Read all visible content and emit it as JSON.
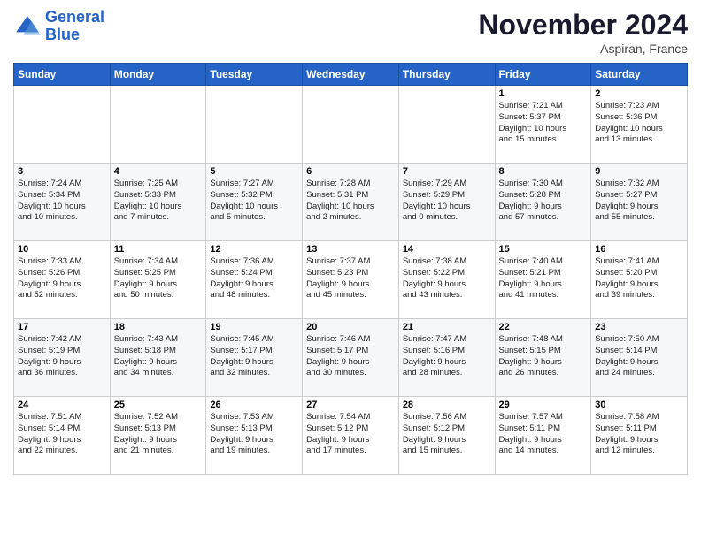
{
  "logo": {
    "line1": "General",
    "line2": "Blue"
  },
  "title": "November 2024",
  "location": "Aspiran, France",
  "headers": [
    "Sunday",
    "Monday",
    "Tuesday",
    "Wednesday",
    "Thursday",
    "Friday",
    "Saturday"
  ],
  "weeks": [
    [
      {
        "day": "",
        "info": ""
      },
      {
        "day": "",
        "info": ""
      },
      {
        "day": "",
        "info": ""
      },
      {
        "day": "",
        "info": ""
      },
      {
        "day": "",
        "info": ""
      },
      {
        "day": "1",
        "info": "Sunrise: 7:21 AM\nSunset: 5:37 PM\nDaylight: 10 hours\nand 15 minutes."
      },
      {
        "day": "2",
        "info": "Sunrise: 7:23 AM\nSunset: 5:36 PM\nDaylight: 10 hours\nand 13 minutes."
      }
    ],
    [
      {
        "day": "3",
        "info": "Sunrise: 7:24 AM\nSunset: 5:34 PM\nDaylight: 10 hours\nand 10 minutes."
      },
      {
        "day": "4",
        "info": "Sunrise: 7:25 AM\nSunset: 5:33 PM\nDaylight: 10 hours\nand 7 minutes."
      },
      {
        "day": "5",
        "info": "Sunrise: 7:27 AM\nSunset: 5:32 PM\nDaylight: 10 hours\nand 5 minutes."
      },
      {
        "day": "6",
        "info": "Sunrise: 7:28 AM\nSunset: 5:31 PM\nDaylight: 10 hours\nand 2 minutes."
      },
      {
        "day": "7",
        "info": "Sunrise: 7:29 AM\nSunset: 5:29 PM\nDaylight: 10 hours\nand 0 minutes."
      },
      {
        "day": "8",
        "info": "Sunrise: 7:30 AM\nSunset: 5:28 PM\nDaylight: 9 hours\nand 57 minutes."
      },
      {
        "day": "9",
        "info": "Sunrise: 7:32 AM\nSunset: 5:27 PM\nDaylight: 9 hours\nand 55 minutes."
      }
    ],
    [
      {
        "day": "10",
        "info": "Sunrise: 7:33 AM\nSunset: 5:26 PM\nDaylight: 9 hours\nand 52 minutes."
      },
      {
        "day": "11",
        "info": "Sunrise: 7:34 AM\nSunset: 5:25 PM\nDaylight: 9 hours\nand 50 minutes."
      },
      {
        "day": "12",
        "info": "Sunrise: 7:36 AM\nSunset: 5:24 PM\nDaylight: 9 hours\nand 48 minutes."
      },
      {
        "day": "13",
        "info": "Sunrise: 7:37 AM\nSunset: 5:23 PM\nDaylight: 9 hours\nand 45 minutes."
      },
      {
        "day": "14",
        "info": "Sunrise: 7:38 AM\nSunset: 5:22 PM\nDaylight: 9 hours\nand 43 minutes."
      },
      {
        "day": "15",
        "info": "Sunrise: 7:40 AM\nSunset: 5:21 PM\nDaylight: 9 hours\nand 41 minutes."
      },
      {
        "day": "16",
        "info": "Sunrise: 7:41 AM\nSunset: 5:20 PM\nDaylight: 9 hours\nand 39 minutes."
      }
    ],
    [
      {
        "day": "17",
        "info": "Sunrise: 7:42 AM\nSunset: 5:19 PM\nDaylight: 9 hours\nand 36 minutes."
      },
      {
        "day": "18",
        "info": "Sunrise: 7:43 AM\nSunset: 5:18 PM\nDaylight: 9 hours\nand 34 minutes."
      },
      {
        "day": "19",
        "info": "Sunrise: 7:45 AM\nSunset: 5:17 PM\nDaylight: 9 hours\nand 32 minutes."
      },
      {
        "day": "20",
        "info": "Sunrise: 7:46 AM\nSunset: 5:17 PM\nDaylight: 9 hours\nand 30 minutes."
      },
      {
        "day": "21",
        "info": "Sunrise: 7:47 AM\nSunset: 5:16 PM\nDaylight: 9 hours\nand 28 minutes."
      },
      {
        "day": "22",
        "info": "Sunrise: 7:48 AM\nSunset: 5:15 PM\nDaylight: 9 hours\nand 26 minutes."
      },
      {
        "day": "23",
        "info": "Sunrise: 7:50 AM\nSunset: 5:14 PM\nDaylight: 9 hours\nand 24 minutes."
      }
    ],
    [
      {
        "day": "24",
        "info": "Sunrise: 7:51 AM\nSunset: 5:14 PM\nDaylight: 9 hours\nand 22 minutes."
      },
      {
        "day": "25",
        "info": "Sunrise: 7:52 AM\nSunset: 5:13 PM\nDaylight: 9 hours\nand 21 minutes."
      },
      {
        "day": "26",
        "info": "Sunrise: 7:53 AM\nSunset: 5:13 PM\nDaylight: 9 hours\nand 19 minutes."
      },
      {
        "day": "27",
        "info": "Sunrise: 7:54 AM\nSunset: 5:12 PM\nDaylight: 9 hours\nand 17 minutes."
      },
      {
        "day": "28",
        "info": "Sunrise: 7:56 AM\nSunset: 5:12 PM\nDaylight: 9 hours\nand 15 minutes."
      },
      {
        "day": "29",
        "info": "Sunrise: 7:57 AM\nSunset: 5:11 PM\nDaylight: 9 hours\nand 14 minutes."
      },
      {
        "day": "30",
        "info": "Sunrise: 7:58 AM\nSunset: 5:11 PM\nDaylight: 9 hours\nand 12 minutes."
      }
    ]
  ]
}
